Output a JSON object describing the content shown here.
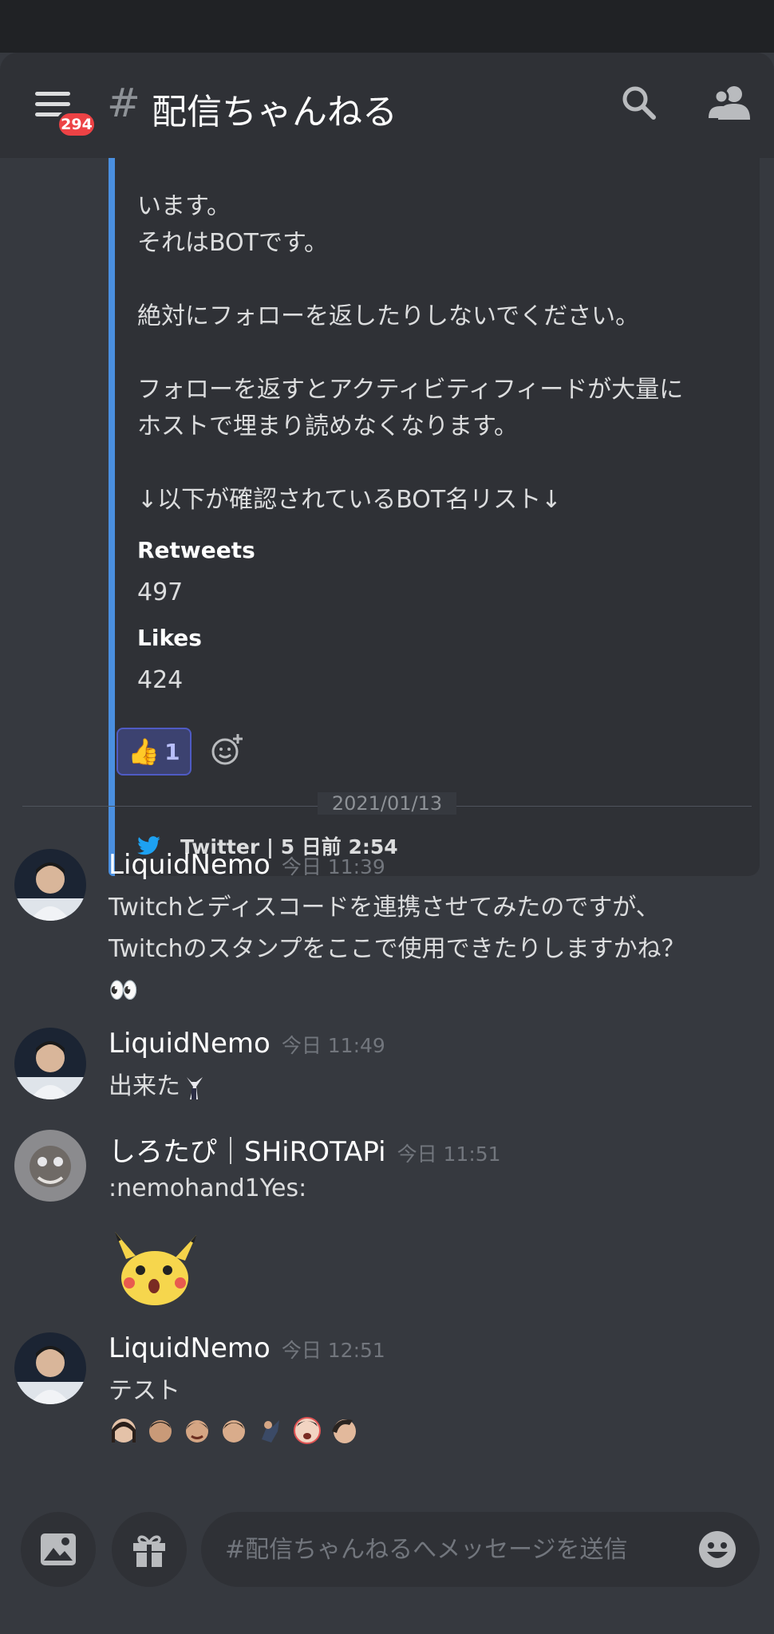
{
  "header": {
    "unread_count": "294",
    "hash": "#",
    "channel_name": "配信ちゃんねる"
  },
  "embed": {
    "text_lines": [
      "います。",
      "それはBOTです。",
      "",
      "絶対にフォローを返したりしないでください。",
      "",
      "フォローを返すとアクティビティフィードが大量に",
      "ホストで埋まり読めなくなります。",
      "",
      "↓以下が確認されているBOT名リスト↓"
    ],
    "fields": [
      {
        "name": "Retweets",
        "value": "497"
      },
      {
        "name": "Likes",
        "value": "424"
      }
    ],
    "footer": "Twitter | 5 日前 2:54",
    "accent_color": "#4a8fe0"
  },
  "reaction": {
    "emoji": "👍",
    "count": "1",
    "icon": "thumbs-up-icon",
    "add_icon": "add-reaction-icon"
  },
  "date_divider": "2021/01/13",
  "messages": [
    {
      "author": "LiquidNemo",
      "timestamp": "今日 11:39",
      "lines": [
        "Twitchとディスコードを連携させてみたのですが、",
        "Twitchのスタンプをここで使用できたりしますかね？",
        "👀"
      ]
    },
    {
      "author": "LiquidNemo",
      "timestamp": "今日 11:49",
      "lines": [
        "出来た"
      ]
    },
    {
      "author": "しろたぴ｜SHiROTAPi",
      "timestamp": "今日 11:51",
      "lines": [
        ":nemohand1Yes:"
      ]
    },
    {
      "author": "LiquidNemo",
      "timestamp": "今日 12:51",
      "lines": [
        "テスト"
      ]
    }
  ],
  "input": {
    "placeholder": "#配信ちゃんねるへメッセージを送信"
  },
  "icons": {
    "menu": "hamburger-menu-icon",
    "search": "search-icon",
    "members": "members-icon",
    "image": "image-icon",
    "gift": "gift-icon",
    "emoji": "emoji-icon"
  },
  "colors": {
    "background": "#36393f",
    "header": "#2f3136",
    "badge": "#ed4245",
    "reaction": "#3c4270"
  }
}
